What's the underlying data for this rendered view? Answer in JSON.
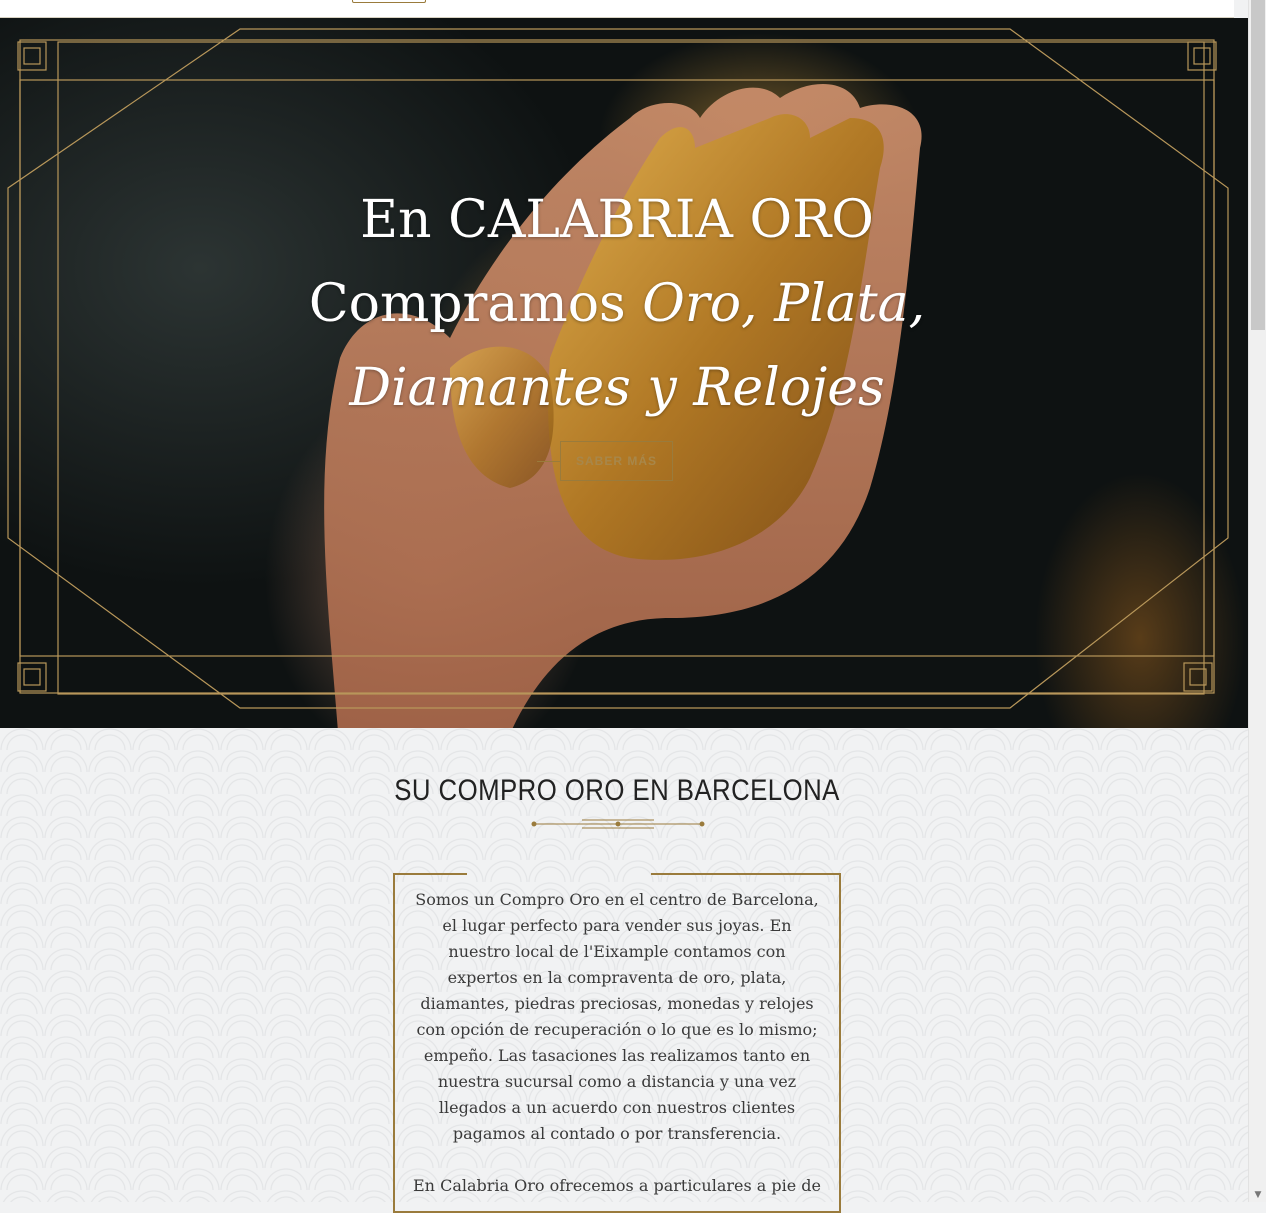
{
  "hero": {
    "line1": "En CALABRIA ORO",
    "line2_plain": "Compramos ",
    "line2_italic": "Oro, Plata,",
    "line3_italic": "Diamantes y Relojes",
    "cta_label": "SABER MÁS"
  },
  "intro": {
    "title": "SU COMPRO ORO EN BARCELONA",
    "paragraph1": "Somos un Compro Oro en el centro de Barcelona, el lugar perfecto para vender sus joyas. En nuestro local de l'Eixample contamos con expertos en la compraventa de oro, plata, diamantes, piedras preciosas, monedas y relojes con opción de recuperación o lo que es lo mismo; empeño. Las tasaciones las realizamos tanto en nuestra sucursal como a distancia y una vez llegados a un acuerdo con nuestros clientes pagamos al contado o por transferencia.",
    "paragraph2": "En Calabria Oro ofrecemos a particulares a pie de"
  },
  "colors": {
    "gold": "#9a7b3c",
    "section_bg": "#f1f2f3"
  },
  "scrollbar": {
    "arrow_icon": "triangle-down-icon"
  }
}
